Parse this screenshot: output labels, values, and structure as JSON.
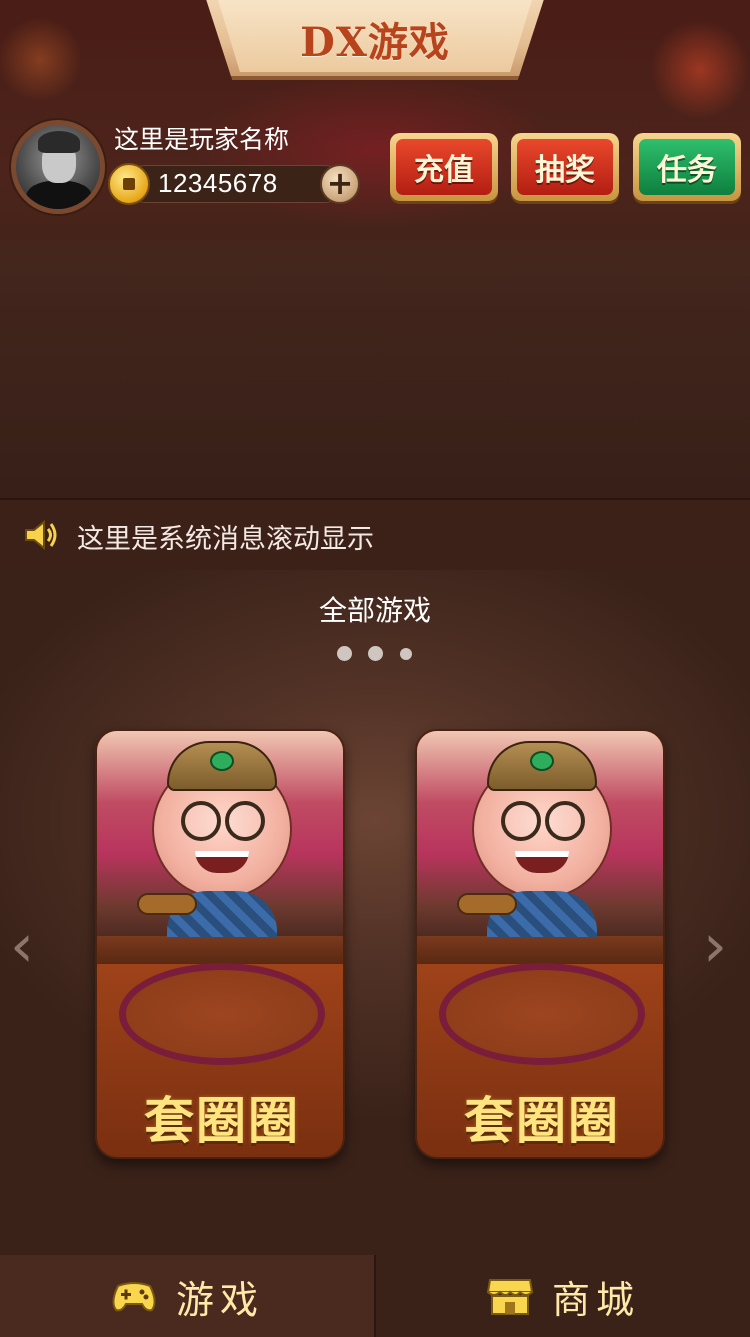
{
  "header": {
    "title": "DX游戏"
  },
  "player": {
    "name": "这里是玩家名称",
    "coins": "12345678",
    "add_coins_label": "+"
  },
  "actions": [
    {
      "label": "充值",
      "color": "#d7351d"
    },
    {
      "label": "抽奖",
      "color": "#d7351d"
    },
    {
      "label": "任务",
      "color": "#1a9b52"
    }
  ],
  "notice": {
    "icon": "speaker-icon",
    "text": "这里是系统消息滚动显示"
  },
  "games": {
    "section_title": "全部游戏",
    "page_count": 3,
    "cards": [
      {
        "label": "套圈圈"
      },
      {
        "label": "套圈圈"
      }
    ],
    "prev_icon": "chevron-left-icon",
    "next_icon": "chevron-right-icon",
    "prev_glyph": "‹",
    "next_glyph": "›"
  },
  "tabbar": {
    "games_label": "游戏",
    "shop_label": "商城",
    "games_icon": "gamepad-icon",
    "shop_icon": "store-icon"
  },
  "colors": {
    "background": "#3a2018",
    "accent_gold": "#ffe480",
    "title_red": "#b8441d"
  }
}
